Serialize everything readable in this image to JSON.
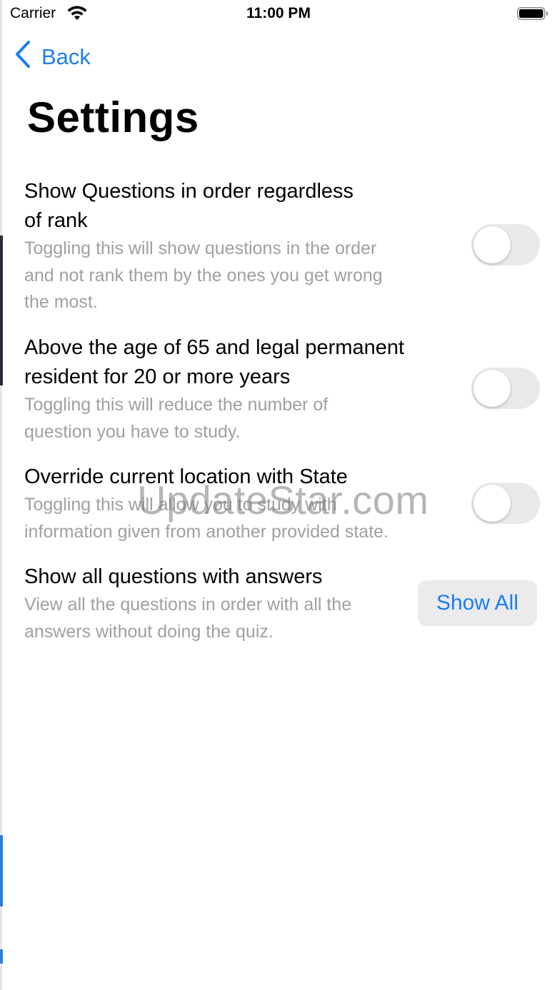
{
  "status_bar": {
    "carrier": "Carrier",
    "time": "11:00 PM",
    "wifi_icon": "wifi-icon",
    "battery_icon": "battery-full-icon"
  },
  "nav": {
    "back_label": "Back",
    "back_icon": "chevron-left-icon"
  },
  "page": {
    "title": "Settings"
  },
  "settings": [
    {
      "title_line1": "Show Questions in order regardless",
      "title_line2": "of rank",
      "desc_line1": "Toggling this will show questions in the order",
      "desc_line2": "and not rank them by the ones you get wrong",
      "desc_line3": "the most.",
      "control": "toggle",
      "on": false
    },
    {
      "title_line1": "Above the age of 65 and legal permanent",
      "title_line2": "resident for 20 or more years",
      "desc_line1": "Toggling this will reduce the number of",
      "desc_line2": "question you have to study.",
      "control": "toggle",
      "on": false
    },
    {
      "title_line1": "Override current location with State",
      "desc_line1": "Toggling this will allow you to study with",
      "desc_line2": "information given from another provided state.",
      "control": "toggle",
      "on": false
    },
    {
      "title_line1": "Show all questions with answers",
      "desc_line1": "View all the questions in order with all the",
      "desc_line2": "answers without doing the quiz.",
      "control": "button",
      "button_label": "Show All"
    }
  ],
  "watermark": "UpdateStar.com",
  "colors": {
    "accent": "#1a7ef0",
    "secondary_text": "#a0a0a4",
    "toggle_off": "#e9e9eb",
    "button_bg": "#ebebed"
  }
}
